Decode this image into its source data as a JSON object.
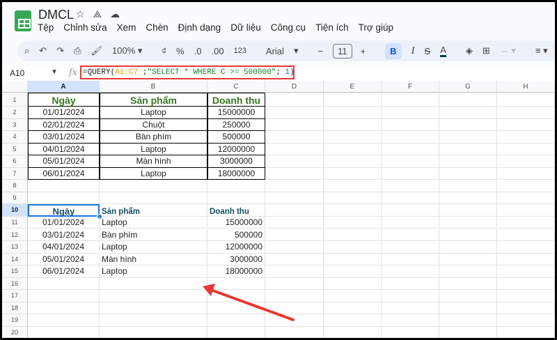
{
  "app": {
    "title": "DMCL",
    "icons": [
      "star-icon",
      "move-to-drive-icon",
      "cloud-saved-icon"
    ]
  },
  "menu": [
    "Tệp",
    "Chỉnh sửa",
    "Xem",
    "Chèn",
    "Định dạng",
    "Dữ liệu",
    "Công cụ",
    "Tiện ích",
    "Trợ giúp"
  ],
  "toolbar": {
    "zoom": "100%",
    "currency": "₫",
    "percent": "%",
    "dec_decrease": ".0",
    "dec_increase": ".00",
    "number_format": "123",
    "font": "Arial",
    "font_size": "11",
    "minus": "−",
    "plus": "+",
    "bold": "B",
    "italic": "I",
    "strike": "S",
    "text_color": "A"
  },
  "formula_bar": {
    "cell_ref": "A10",
    "fx": "fx",
    "formula_fn": "=QUERY(",
    "formula_range": "A1:C7",
    "formula_sep": " ;",
    "formula_str": "\"SELECT * WHERE C >= 500000\"",
    "formula_sep2": "; ",
    "formula_num": "1",
    "formula_end": ")"
  },
  "columns": [
    "A",
    "B",
    "C",
    "D",
    "E",
    "F",
    "G",
    "H"
  ],
  "rows": [
    "1",
    "2",
    "3",
    "4",
    "5",
    "6",
    "7",
    "8",
    "9",
    "10",
    "11",
    "12",
    "13",
    "14",
    "15",
    "16",
    "17",
    "18",
    "19",
    "20"
  ],
  "source_table": {
    "headers": [
      "Ngày",
      "Sản phẩm",
      "Doanh thu"
    ],
    "rows": [
      [
        "01/01/2024",
        "Laptop",
        "15000000"
      ],
      [
        "02/01/2024",
        "Chuột",
        "250000"
      ],
      [
        "03/01/2024",
        "Bàn phím",
        "500000"
      ],
      [
        "04/01/2024",
        "Laptop",
        "12000000"
      ],
      [
        "05/01/2024",
        "Màn hình",
        "3000000"
      ],
      [
        "06/01/2024",
        "Laptop",
        "18000000"
      ]
    ]
  },
  "result_table": {
    "headers": [
      "Ngày",
      "Sản phẩm",
      "Doanh thu"
    ],
    "rows": [
      [
        "01/01/2024",
        "Laptop",
        "15000000"
      ],
      [
        "03/01/2024",
        "Bàn phím",
        "500000"
      ],
      [
        "04/01/2024",
        "Laptop",
        "12000000"
      ],
      [
        "05/01/2024",
        "Màn hình",
        "3000000"
      ],
      [
        "06/01/2024",
        "Laptop",
        "18000000"
      ]
    ]
  },
  "colors": {
    "header_green": "#38761d",
    "header_teal": "#134f5c",
    "selection": "#1a73e8",
    "arrow": "#e53935"
  }
}
